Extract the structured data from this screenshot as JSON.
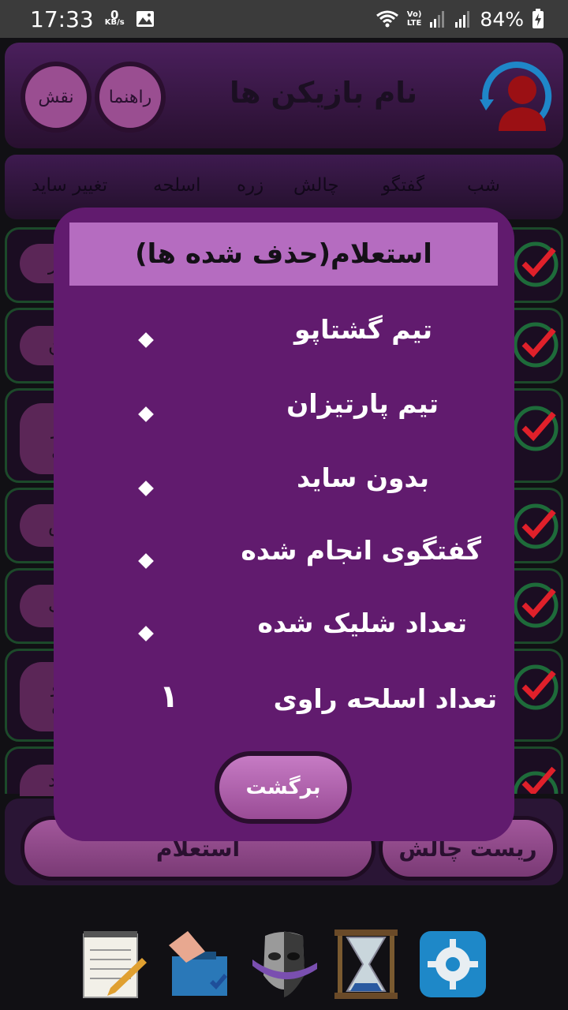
{
  "status_bar": {
    "time": "17:33",
    "net_speed_value": "0",
    "net_speed_unit": "KB/s",
    "lte_top": "Vo)",
    "lte_bottom": "LTE",
    "battery": "84%"
  },
  "header": {
    "title": "نام بازیکن ها",
    "guide_button": "راهنما",
    "role_button": "نقش"
  },
  "tabs": [
    "شب",
    "گفتگو",
    "چالش",
    "زره",
    "اسلحه",
    "تغییر ساید"
  ],
  "rows_partial": [
    "ر",
    "ن",
    "ر",
    "ال",
    "س",
    "رت",
    "پو",
    "ه",
    "رد"
  ],
  "bottom": {
    "inquiry_button": "استعلام",
    "reset_button": "ریست چالش"
  },
  "modal": {
    "title": "استعلام(حذف شده ها)",
    "items": [
      {
        "label": "تیم گشتاپو",
        "value": ""
      },
      {
        "label": "تیم پارتیزان",
        "value": ""
      },
      {
        "label": "بدون ساید",
        "value": ""
      },
      {
        "label": "گفتگوی انجام شده",
        "value": ""
      },
      {
        "label": "تعداد شلیک شده",
        "value": ""
      },
      {
        "label": "تعداد اسلحه راوی",
        "value": "۱"
      }
    ],
    "back_button": "برگشت"
  },
  "colors": {
    "modal_bg": "#611b6e",
    "modal_header": "#b56cc0",
    "button": "#9a4e91",
    "check_red": "#e0202a",
    "check_green": "#1e6b3a"
  }
}
